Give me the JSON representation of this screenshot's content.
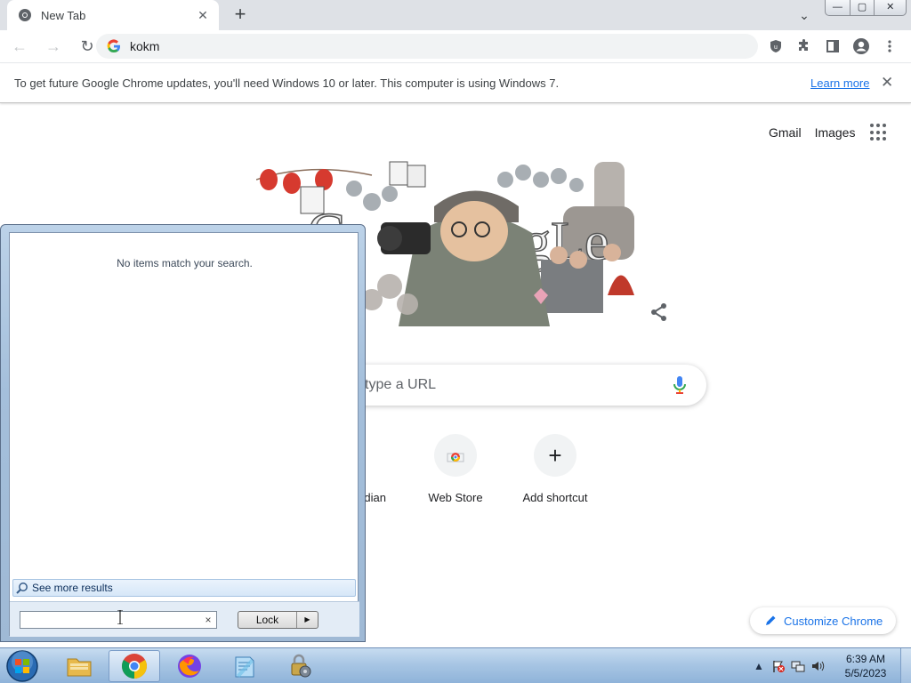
{
  "browser": {
    "tab": {
      "title": "New Tab",
      "close": "✕"
    },
    "new_tab": "+",
    "tab_search": "⌄",
    "window_controls": {
      "minimize": "—",
      "maximize": "▢",
      "close": "✕"
    },
    "omnibox": {
      "value": "kokm"
    },
    "nav": {
      "back": "←",
      "forward": "→",
      "reload": "↻"
    }
  },
  "infobar": {
    "message": "To get future Google Chrome updates, you'll need Windows 10 or later. This computer is using Windows 7.",
    "link": "Learn more",
    "close": "✕"
  },
  "ntp": {
    "top_links": {
      "gmail": "Gmail",
      "images": "Images"
    },
    "search_placeholder": "type a URL",
    "shortcuts": [
      {
        "label": "dian"
      },
      {
        "label": "Web Store"
      },
      {
        "label": "Add shortcut",
        "icon": "+"
      }
    ],
    "customize_label": "Customize Chrome"
  },
  "start_menu": {
    "no_items": "No items match your search.",
    "see_more": "See more results",
    "search_value": "",
    "search_clear": "×",
    "lock_label": "Lock",
    "lock_arrow": "▶"
  },
  "taskbar": {
    "tasks": [
      "explorer",
      "chrome",
      "firefox",
      "notepad",
      "control-panel"
    ],
    "tray_arrow": "▲",
    "clock": {
      "time": "6:39 AM",
      "date": "5/5/2023"
    }
  },
  "colors": {
    "accent_blue": "#1a73e8",
    "taskbar": "#a8c6e4",
    "start_menu": "#bcd2e8"
  }
}
